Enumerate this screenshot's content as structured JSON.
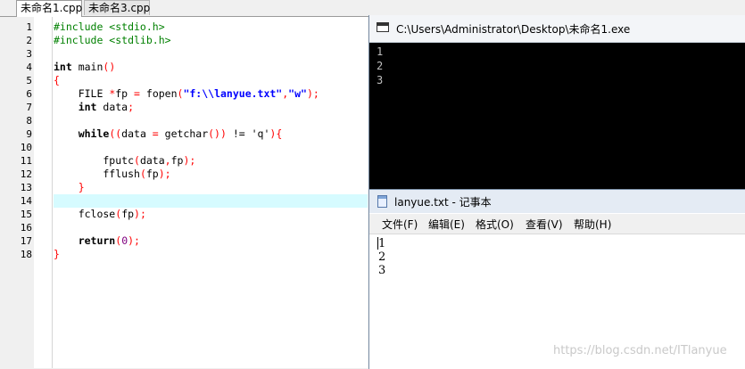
{
  "editor": {
    "tabs": [
      {
        "label": "未命名1.cpp",
        "active": true
      },
      {
        "label": "未命名3.cpp",
        "active": false
      }
    ],
    "line_numbers": [
      "1",
      "2",
      "3",
      "4",
      "5",
      "6",
      "7",
      "8",
      "9",
      "10",
      "11",
      "12",
      "13",
      "14",
      "15",
      "16",
      "17",
      "18"
    ],
    "code": {
      "l1": "#include <stdio.h>",
      "l2": "#include <stdlib.h>",
      "l4_kw": "int",
      "l4_rest": " main",
      "l4_paren": "()",
      "l5": "{",
      "l6_a": "    FILE ",
      "l6_b": "*",
      "l6_c": "fp ",
      "l6_d": "=",
      "l6_e": " fopen",
      "l6_f": "(",
      "l6_g": "\"f:\\\\lanyue.txt\"",
      "l6_h": ",",
      "l6_i": "\"w\"",
      "l6_j": ");",
      "l7_kw": "    int",
      "l7_rest": " data",
      "l7_semi": ";",
      "l9_kw": "    while",
      "l9_a": "((",
      "l9_b": "data ",
      "l9_c": "=",
      "l9_d": " getchar",
      "l9_e": "())",
      "l9_f": " != ",
      "l9_g": "'q'",
      "l9_h": "){",
      "l11_a": "        fputc",
      "l11_b": "(",
      "l11_c": "data",
      "l11_d": ",",
      "l11_e": "fp",
      "l11_f": ");",
      "l12_a": "        fflush",
      "l12_b": "(",
      "l12_c": "fp",
      "l12_d": ");",
      "l13": "    }",
      "l15_a": "    fclose",
      "l15_b": "(",
      "l15_c": "fp",
      "l15_d": ");",
      "l17_kw": "    return",
      "l17_a": "(",
      "l17_b": "0",
      "l17_c": ");",
      "l18": "}"
    }
  },
  "console": {
    "title": "C:\\Users\\Administrator\\Desktop\\未命名1.exe",
    "lines": [
      "1",
      "2",
      "3"
    ]
  },
  "notepad": {
    "title": "lanyue.txt - 记事本",
    "menu": [
      "文件(F)",
      "编辑(E)",
      "格式(O)",
      "查看(V)",
      "帮助(H)"
    ],
    "lines": [
      "1",
      "2",
      "3"
    ]
  },
  "watermark": "https://blog.csdn.net/ITlanyue",
  "colors": {
    "preprocessor": "#008000",
    "string": "#0000ff",
    "symbol": "#ff0000",
    "number": "#800080",
    "current_line": "#d6fbff"
  }
}
